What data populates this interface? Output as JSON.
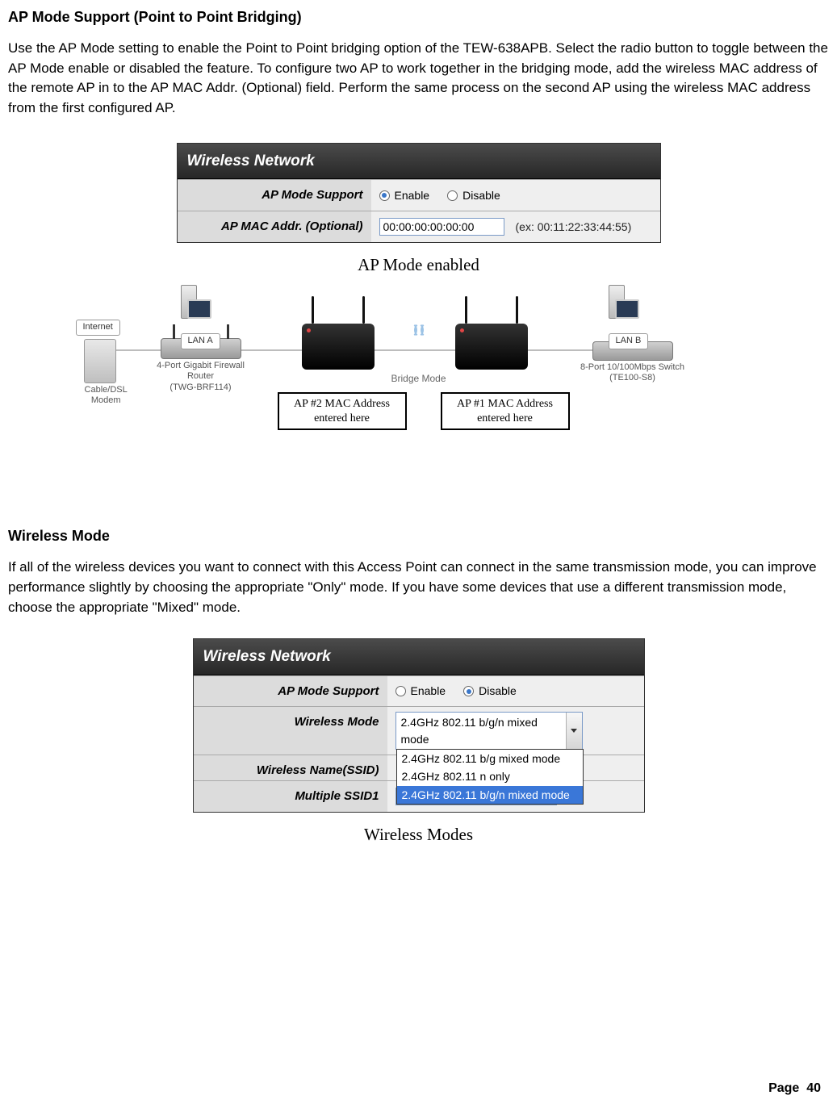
{
  "section1": {
    "heading": "AP Mode Support (Point to Point Bridging)",
    "body": "Use the AP Mode setting to enable the Point to Point bridging option of the TEW-638APB. Select the radio button to toggle between the AP Mode enable or disabled the feature. To configure two AP to work together in the bridging mode, add the wireless MAC address of the remote AP in to the AP MAC Addr. (Optional) field. Perform the same process on the second AP using the wireless MAC address from the first configured AP.",
    "caption": "AP Mode enabled"
  },
  "panel1": {
    "title": "Wireless Network",
    "row1_label": "AP Mode Support",
    "enable_text": "Enable",
    "disable_text": "Disable",
    "enable_checked": true,
    "row2_label": "AP MAC Addr. (Optional)",
    "mac_value": "00:00:00:00:00:00",
    "hint": "(ex: 00:11:22:33:44:55)"
  },
  "diagram": {
    "internet": "Internet",
    "modem": "Cable/DSL\nModem",
    "router": "4-Port Gigabit Firewall Router\n(TWG-BRF114)",
    "lan_a": "LAN A",
    "lan_b": "LAN B",
    "bridge_mode": "Bridge Mode",
    "switch": "8-Port 10/100Mbps Switch\n(TE100-S8)",
    "callout_left": "AP #2 MAC Address entered here",
    "callout_right": "AP #1 MAC Address entered here"
  },
  "section2": {
    "heading": "Wireless Mode",
    "body": "If all of the wireless devices you want to connect with this Access Point can connect in the same transmission mode, you can improve performance slightly by choosing the appropriate \"Only\" mode. If you have some devices that use a different transmission mode, choose the appropriate \"Mixed\" mode.",
    "caption": "Wireless Modes"
  },
  "panel2": {
    "title": "Wireless Network",
    "row1_label": "AP Mode Support",
    "enable_text": "Enable",
    "disable_text": "Disable",
    "disable_checked": true,
    "row2_label": "Wireless Mode",
    "selected": "2.4GHz 802.11 b/g/n mixed mode",
    "options": [
      "2.4GHz 802.11 b/g mixed mode",
      "2.4GHz 802.11 n only",
      "2.4GHz 802.11 b/g/n mixed mode"
    ],
    "row3_label": "Wireless Name(SSID)",
    "row4_label": "Multiple SSID1"
  },
  "footer": {
    "page_word": "Page",
    "page_num": "40"
  }
}
